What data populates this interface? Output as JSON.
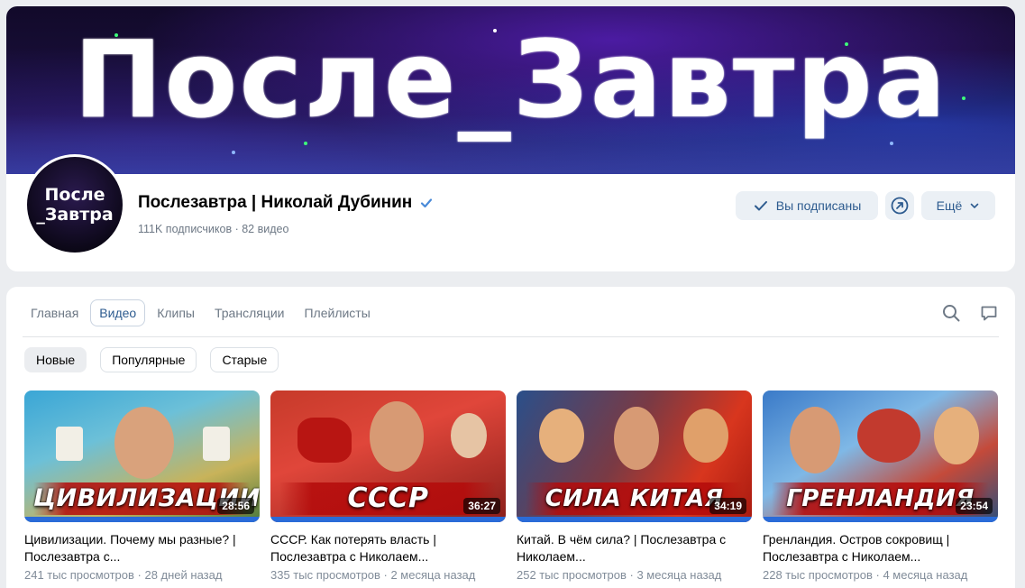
{
  "banner": {
    "title": "После_Завтра"
  },
  "avatar": {
    "line1": "После",
    "line2": "_Завтра"
  },
  "channel": {
    "name": "Послезавтра | Николай Дубинин",
    "meta": "111K подписчиков · 82 видео"
  },
  "actions": {
    "subscribed_label": "Вы подписаны",
    "more_label": "Ещё"
  },
  "tabs": [
    {
      "label": "Главная",
      "active": false
    },
    {
      "label": "Видео",
      "active": true
    },
    {
      "label": "Клипы",
      "active": false
    },
    {
      "label": "Трансляции",
      "active": false
    },
    {
      "label": "Плейлисты",
      "active": false
    }
  ],
  "filters": [
    {
      "label": "Новые",
      "active": true
    },
    {
      "label": "Популярные",
      "active": false
    },
    {
      "label": "Старые",
      "active": false
    }
  ],
  "videos": [
    {
      "caption": "ЦИВИЛИЗАЦИИ",
      "duration": "28:56",
      "title": "Цивилизации. Почему мы разные? | Послезавтра с...",
      "meta": "241 тыс просмотров · 28 дней назад"
    },
    {
      "caption": "СССР",
      "duration": "36:27",
      "title": "СССР. Как потерять власть | Послезавтра с Николаем...",
      "meta": "335 тыс просмотров · 2 месяца назад"
    },
    {
      "caption": "СИЛА КИТАЯ",
      "duration": "34:19",
      "title": "Китай. В чём сила? | Послезавтра с Николаем...",
      "meta": "252 тыс просмотров · 3 месяца назад"
    },
    {
      "caption": "ГРЕНЛАНДИЯ",
      "duration": "23:54",
      "title": "Гренландия. Остров сокровищ | Послезавтра с Николаем...",
      "meta": "228 тыс просмотров · 4 месяца назад"
    }
  ],
  "colors": {
    "accent": "#2d5b8f",
    "verified": "#4a8ad8",
    "background": "#ebedf0"
  }
}
